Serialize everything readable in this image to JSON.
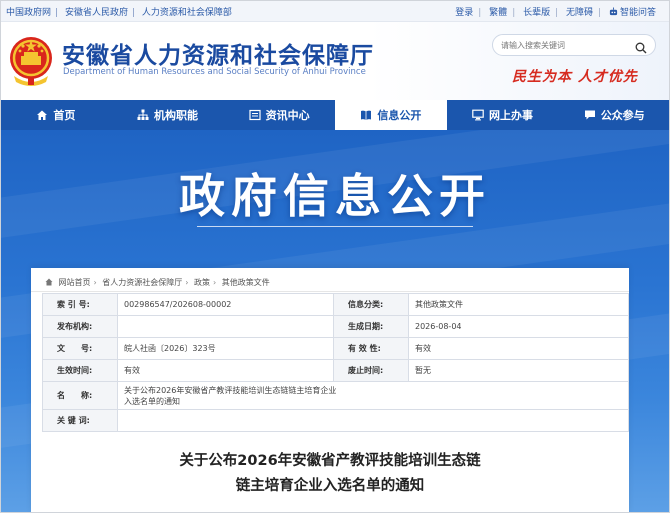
{
  "topbar": {
    "left_links": [
      "中国政府网",
      "安徽省人民政府",
      "人力资源和社会保障部"
    ],
    "right_links": [
      "登录",
      "繁體",
      "长辈版",
      "无障碍",
      "智能问答"
    ]
  },
  "header": {
    "site_name_cn": "安徽省人力资源和社会保障厅",
    "site_name_en": "Department of Human Resources and Social Security of Anhui Province",
    "search_placeholder": "请输入搜索关键词",
    "slogan": "民生为本  人才优先"
  },
  "nav": {
    "items": [
      {
        "label": "首页",
        "icon": "home-icon"
      },
      {
        "label": "机构职能",
        "icon": "org-chart-icon"
      },
      {
        "label": "资讯中心",
        "icon": "news-icon"
      },
      {
        "label": "信息公开",
        "icon": "book-icon"
      },
      {
        "label": "网上办事",
        "icon": "monitor-icon"
      },
      {
        "label": "公众参与",
        "icon": "chat-icon"
      }
    ],
    "active": "信息公开"
  },
  "banner": {
    "title": "政府信息公开"
  },
  "breadcrumb": [
    "网站首页",
    "省人力资源社会保障厅",
    "政策",
    "其他政策文件"
  ],
  "meta": {
    "index_label": "索 引 号:",
    "index_value": "002986547/202608-00002",
    "category_label": "信息分类:",
    "category_value": "其他政策文件",
    "publisher_label": "发布机构:",
    "publisher_value": "",
    "date_label": "生成日期:",
    "date_value": "2026-08-04",
    "docno_label": "文　　号:",
    "docno_value": "皖人社函〔2026〕323号",
    "validity_label": "有 效 性:",
    "validity_value": "有效",
    "effective_label": "生效时间:",
    "effective_value": "有效",
    "repeal_label": "废止时间:",
    "repeal_value": "暂无",
    "name_label": "名　　称:",
    "name_value": "关于公布2026年安徽省产教评技能培训生态链链主培育企业入选名单的通知",
    "keywords_label": "关 键 词:",
    "keywords_value": ""
  },
  "document": {
    "title_line1": "关于公布2026年安徽省产教评技能培训生态链",
    "title_line2": "链主培育企业入选名单的通知"
  },
  "colors": {
    "primary": "#1b56ad",
    "banner": "#2a74d2",
    "slogan": "#d62b20"
  }
}
